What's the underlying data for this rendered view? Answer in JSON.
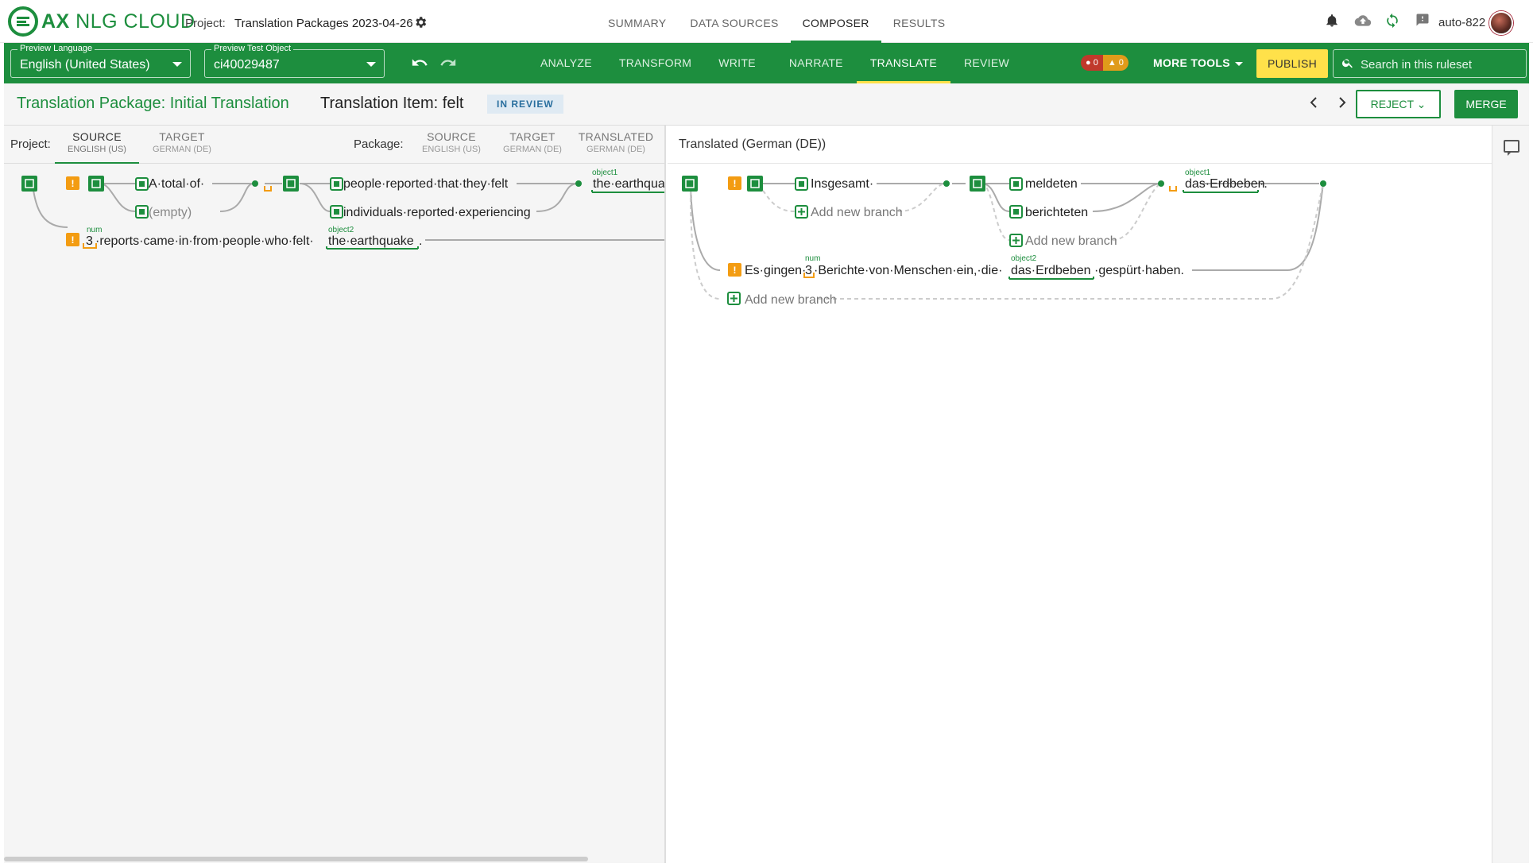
{
  "app": {
    "logo_ax": "AX",
    "logo_rest": " NLG CLOUD",
    "project_label": "Project:",
    "project_name": "Translation Packages 2023-04-26"
  },
  "mainnav": {
    "tabs": [
      "SUMMARY",
      "DATA SOURCES",
      "COMPOSER",
      "RESULTS"
    ],
    "active": "COMPOSER"
  },
  "user": {
    "name": "auto-822"
  },
  "toolbar": {
    "preview_language_label": "Preview Language",
    "preview_language_value": "English (United States)",
    "preview_object_label": "Preview Test Object",
    "preview_object_value": "ci40029487",
    "subtabs": [
      "ANALYZE",
      "TRANSFORM",
      "WRITE",
      "NARRATE",
      "TRANSLATE",
      "REVIEW"
    ],
    "active_subtab": "TRANSLATE",
    "error_count": "0",
    "warning_count": "0",
    "more_tools": "MORE TOOLS",
    "publish": "PUBLISH",
    "search_placeholder": "Search in this ruleset"
  },
  "titlebar": {
    "package_title": "Translation Package: Initial Translation",
    "item_title": "Translation Item: felt",
    "status": "IN REVIEW",
    "reject": "REJECT",
    "merge": "MERGE"
  },
  "left": {
    "project_label": "Project:",
    "package_label": "Package:",
    "tabs": [
      {
        "t1": "SOURCE",
        "t2": "ENGLISH (US)"
      },
      {
        "t1": "TARGET",
        "t2": "GERMAN (DE)"
      },
      {
        "t1": "SOURCE",
        "t2": "ENGLISH (US)"
      },
      {
        "t1": "TARGET",
        "t2": "GERMAN (DE)"
      },
      {
        "t1": "TRANSLATED",
        "t2": "GERMAN (DE)"
      }
    ],
    "graph": {
      "a_total_of": "A·total·of·",
      "empty": "(empty)",
      "people_reported": "people·reported·that·they·felt",
      "individuals_reported": "individuals·reported·experiencing",
      "object1_label": "object1",
      "object1_text": "the·earthqua",
      "num_label": "num",
      "num_value": "3",
      "reports_text": "·reports·came·in·from·people·who·felt·",
      "object2_label": "object2",
      "object2_text": "the·earthquake",
      "period": "."
    }
  },
  "right": {
    "title": "Translated (German (DE))",
    "graph": {
      "insgesamt": "Insgesamt·",
      "add_branch": "Add new branch",
      "meldeten": "meldeten",
      "berichteten": "berichteten",
      "object1_label": "object1",
      "object1_text": "das·Erdbeben",
      "period_dot": "·.",
      "es_gingen": "Es·gingen·",
      "num_label": "num",
      "num_value": "3",
      "berichte_text": "·Berichte·von·Menschen·ein,·die·",
      "object2_label": "object2",
      "object2_text": "das·Erdbeben",
      "gespurt": "·gespürt·haben."
    }
  }
}
